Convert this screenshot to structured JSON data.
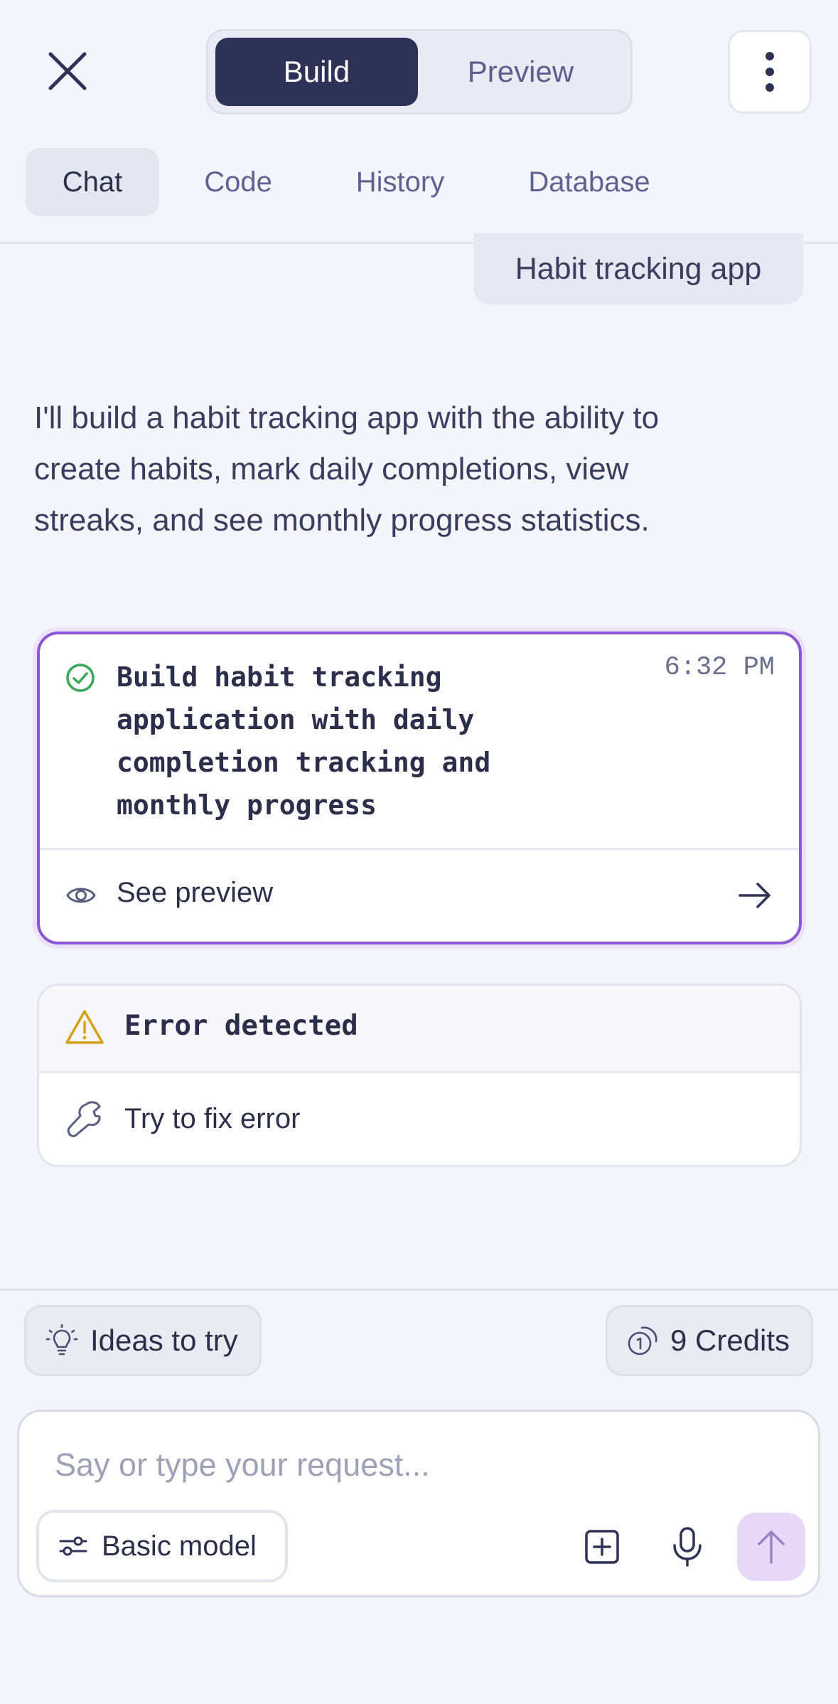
{
  "header": {
    "modes": {
      "build": "Build",
      "preview": "Preview"
    },
    "active_mode": "Build"
  },
  "tabs": [
    {
      "label": "Chat",
      "active": true
    },
    {
      "label": "Code",
      "active": false
    },
    {
      "label": "History",
      "active": false
    },
    {
      "label": "Database",
      "active": false
    }
  ],
  "chat": {
    "user_message": "Habit tracking app",
    "assistant_message": "I'll build a habit tracking app with the ability to create habits, mark daily completions, view streaks, and see monthly progress statistics.",
    "task_card": {
      "title": "Build habit tracking application with daily completion tracking and monthly progress",
      "time": "6:32 PM",
      "action_label": "See preview"
    },
    "error_card": {
      "title": "Error detected",
      "action_label": "Try to fix error"
    }
  },
  "footer": {
    "ideas_label": "Ideas to try",
    "credits_label": "9 Credits",
    "input_placeholder": "Say or type your request...",
    "input_value": "",
    "model_label": "Basic model"
  },
  "colors": {
    "accent_dark": "#2e3257",
    "card_border": "#8a55d6",
    "success": "#3aa757",
    "warning": "#d4a017",
    "send_bg": "#e6d8f6"
  },
  "icons": [
    "close-icon",
    "more-vertical-icon",
    "check-circle-icon",
    "eye-icon",
    "arrow-right-icon",
    "warning-icon",
    "wrench-icon",
    "lightbulb-icon",
    "coin-icon",
    "sliders-icon",
    "add-square-icon",
    "microphone-icon",
    "arrow-up-icon"
  ]
}
